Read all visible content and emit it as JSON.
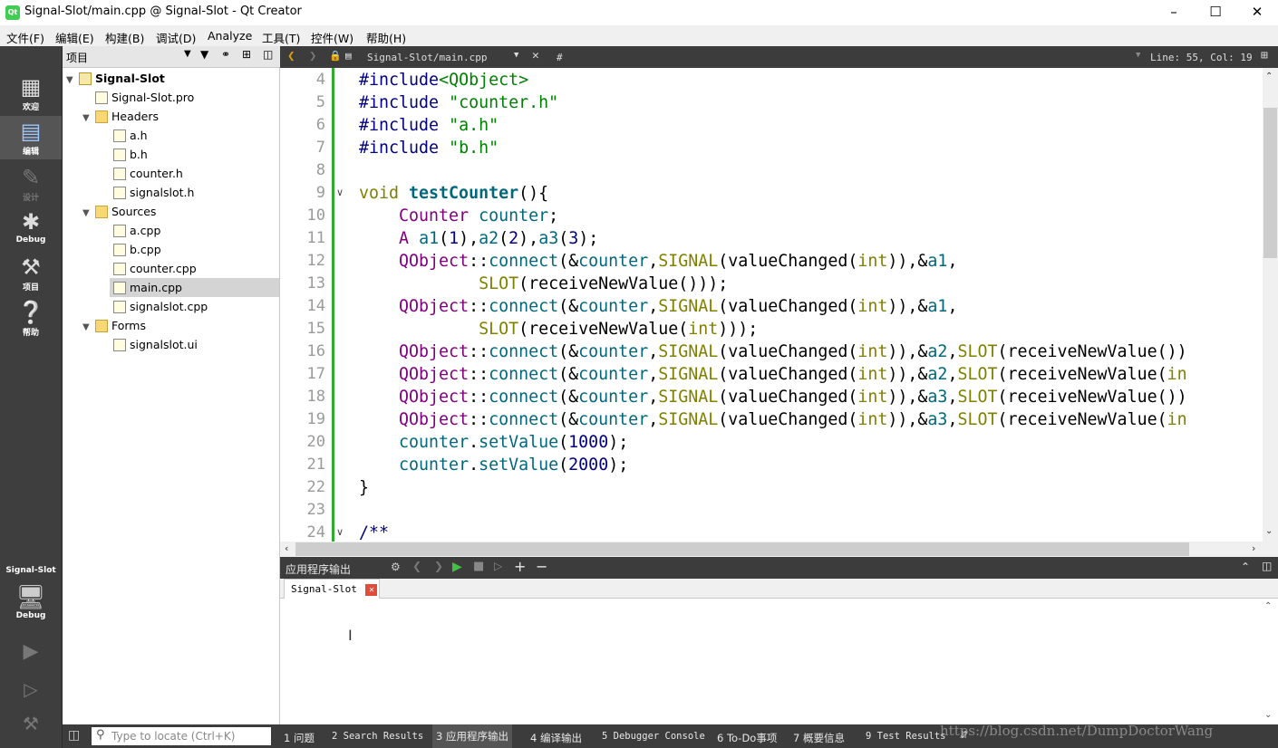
{
  "window": {
    "title": "Signal-Slot/main.cpp @ Signal-Slot - Qt Creator",
    "app_icon": "qt-creator-icon"
  },
  "menu": [
    "文件(F)",
    "编辑(E)",
    "构建(B)",
    "调试(D)",
    "Analyze",
    "工具(T)",
    "控件(W)",
    "帮助(H)"
  ],
  "modes": [
    {
      "label": "欢迎",
      "icon": "grid-icon"
    },
    {
      "label": "编辑",
      "icon": "document-icon"
    },
    {
      "label": "设计",
      "icon": "pen-icon"
    },
    {
      "label": "Debug",
      "icon": "bug-icon"
    },
    {
      "label": "项目",
      "icon": "wrench-icon"
    },
    {
      "label": "帮助",
      "icon": "help-icon"
    }
  ],
  "kit": {
    "project": "Signal-Slot",
    "config": "Debug"
  },
  "project_pane": {
    "title": "项目",
    "tree": [
      {
        "label": "Signal-Slot",
        "depth": 0,
        "type": "project",
        "bold": true
      },
      {
        "label": "Signal-Slot.pro",
        "depth": 1,
        "type": "file"
      },
      {
        "label": "Headers",
        "depth": 1,
        "type": "folder"
      },
      {
        "label": "a.h",
        "depth": 2,
        "type": "file"
      },
      {
        "label": "b.h",
        "depth": 2,
        "type": "file"
      },
      {
        "label": "counter.h",
        "depth": 2,
        "type": "file"
      },
      {
        "label": "signalslot.h",
        "depth": 2,
        "type": "file"
      },
      {
        "label": "Sources",
        "depth": 1,
        "type": "folder"
      },
      {
        "label": "a.cpp",
        "depth": 2,
        "type": "file"
      },
      {
        "label": "b.cpp",
        "depth": 2,
        "type": "file"
      },
      {
        "label": "counter.cpp",
        "depth": 2,
        "type": "file"
      },
      {
        "label": "main.cpp",
        "depth": 2,
        "type": "file",
        "selected": true
      },
      {
        "label": "signalslot.cpp",
        "depth": 2,
        "type": "file"
      },
      {
        "label": "Forms",
        "depth": 1,
        "type": "folder"
      },
      {
        "label": "signalslot.ui",
        "depth": 2,
        "type": "file"
      }
    ]
  },
  "editor": {
    "file": "Signal-Slot/main.cpp",
    "symbol": "#",
    "position": "Line: 55, Col: 19",
    "lines": [
      {
        "n": "4",
        "tokens": [
          [
            "pp",
            "#include"
          ],
          [
            "str",
            "<QObject>"
          ]
        ]
      },
      {
        "n": "5",
        "tokens": [
          [
            "pp",
            "#include "
          ],
          [
            "str",
            "\"counter.h\""
          ]
        ]
      },
      {
        "n": "6",
        "tokens": [
          [
            "pp",
            "#include "
          ],
          [
            "str",
            "\"a.h\""
          ]
        ]
      },
      {
        "n": "7",
        "tokens": [
          [
            "pp",
            "#include "
          ],
          [
            "str",
            "\"b.h\""
          ]
        ]
      },
      {
        "n": "8",
        "tokens": []
      },
      {
        "n": "9",
        "fold": true,
        "tokens": [
          [
            "kw",
            "void "
          ],
          [
            "fn",
            "testCounter"
          ],
          [
            "",
            "(){"
          ]
        ]
      },
      {
        "n": "10",
        "tokens": [
          [
            "",
            "    "
          ],
          [
            "ty",
            "Counter"
          ],
          [
            "",
            " "
          ],
          [
            "fc",
            "counter"
          ],
          [
            "",
            ";"
          ]
        ]
      },
      {
        "n": "11",
        "tokens": [
          [
            "",
            "    "
          ],
          [
            "ty",
            "A"
          ],
          [
            "",
            " "
          ],
          [
            "fc",
            "a1"
          ],
          [
            "",
            "("
          ],
          [
            "num",
            "1"
          ],
          [
            "",
            "),"
          ],
          [
            "fc",
            "a2"
          ],
          [
            "",
            "("
          ],
          [
            "num",
            "2"
          ],
          [
            "",
            "),"
          ],
          [
            "fc",
            "a3"
          ],
          [
            "",
            "("
          ],
          [
            "num",
            "3"
          ],
          [
            "",
            ");"
          ]
        ]
      },
      {
        "n": "12",
        "tokens": [
          [
            "",
            "    "
          ],
          [
            "ty",
            "QObject"
          ],
          [
            "",
            "::"
          ],
          [
            "fc",
            "connect"
          ],
          [
            "",
            "(&"
          ],
          [
            "fc",
            "counter"
          ],
          [
            "",
            ","
          ],
          [
            "mac",
            "SIGNAL"
          ],
          [
            "",
            "(valueChanged("
          ],
          [
            "kw",
            "int"
          ],
          [
            "",
            ")),&"
          ],
          [
            "fc",
            "a1"
          ],
          [
            "",
            ","
          ]
        ]
      },
      {
        "n": "13",
        "tokens": [
          [
            "",
            "            "
          ],
          [
            "mac",
            "SLOT"
          ],
          [
            "",
            "(receiveNewValue()));"
          ]
        ]
      },
      {
        "n": "14",
        "tokens": [
          [
            "",
            "    "
          ],
          [
            "ty",
            "QObject"
          ],
          [
            "",
            "::"
          ],
          [
            "fc",
            "connect"
          ],
          [
            "",
            "(&"
          ],
          [
            "fc",
            "counter"
          ],
          [
            "",
            ","
          ],
          [
            "mac",
            "SIGNAL"
          ],
          [
            "",
            "(valueChanged("
          ],
          [
            "kw",
            "int"
          ],
          [
            "",
            ")),&"
          ],
          [
            "fc",
            "a1"
          ],
          [
            "",
            ","
          ]
        ]
      },
      {
        "n": "15",
        "tokens": [
          [
            "",
            "            "
          ],
          [
            "mac",
            "SLOT"
          ],
          [
            "",
            "(receiveNewValue("
          ],
          [
            "kw",
            "int"
          ],
          [
            "",
            ")));"
          ]
        ]
      },
      {
        "n": "16",
        "tokens": [
          [
            "",
            "    "
          ],
          [
            "ty",
            "QObject"
          ],
          [
            "",
            "::"
          ],
          [
            "fc",
            "connect"
          ],
          [
            "",
            "(&"
          ],
          [
            "fc",
            "counter"
          ],
          [
            "",
            ","
          ],
          [
            "mac",
            "SIGNAL"
          ],
          [
            "",
            "(valueChanged("
          ],
          [
            "kw",
            "int"
          ],
          [
            "",
            ")),&"
          ],
          [
            "fc",
            "a2"
          ],
          [
            "",
            ","
          ],
          [
            "mac",
            "SLOT"
          ],
          [
            "",
            "(receiveNewValue())"
          ]
        ]
      },
      {
        "n": "17",
        "tokens": [
          [
            "",
            "    "
          ],
          [
            "ty",
            "QObject"
          ],
          [
            "",
            "::"
          ],
          [
            "fc",
            "connect"
          ],
          [
            "",
            "(&"
          ],
          [
            "fc",
            "counter"
          ],
          [
            "",
            ","
          ],
          [
            "mac",
            "SIGNAL"
          ],
          [
            "",
            "(valueChanged("
          ],
          [
            "kw",
            "int"
          ],
          [
            "",
            ")),&"
          ],
          [
            "fc",
            "a2"
          ],
          [
            "",
            ","
          ],
          [
            "mac",
            "SLOT"
          ],
          [
            "",
            "(receiveNewValue("
          ],
          [
            "kw",
            "in"
          ]
        ]
      },
      {
        "n": "18",
        "tokens": [
          [
            "",
            "    "
          ],
          [
            "ty",
            "QObject"
          ],
          [
            "",
            "::"
          ],
          [
            "fc",
            "connect"
          ],
          [
            "",
            "(&"
          ],
          [
            "fc",
            "counter"
          ],
          [
            "",
            ","
          ],
          [
            "mac",
            "SIGNAL"
          ],
          [
            "",
            "(valueChanged("
          ],
          [
            "kw",
            "int"
          ],
          [
            "",
            ")),&"
          ],
          [
            "fc",
            "a3"
          ],
          [
            "",
            ","
          ],
          [
            "mac",
            "SLOT"
          ],
          [
            "",
            "(receiveNewValue())"
          ]
        ]
      },
      {
        "n": "19",
        "tokens": [
          [
            "",
            "    "
          ],
          [
            "ty",
            "QObject"
          ],
          [
            "",
            "::"
          ],
          [
            "fc",
            "connect"
          ],
          [
            "",
            "(&"
          ],
          [
            "fc",
            "counter"
          ],
          [
            "",
            ","
          ],
          [
            "mac",
            "SIGNAL"
          ],
          [
            "",
            "(valueChanged("
          ],
          [
            "kw",
            "int"
          ],
          [
            "",
            ")),&"
          ],
          [
            "fc",
            "a3"
          ],
          [
            "",
            ","
          ],
          [
            "mac",
            "SLOT"
          ],
          [
            "",
            "(receiveNewValue("
          ],
          [
            "kw",
            "in"
          ]
        ]
      },
      {
        "n": "20",
        "tokens": [
          [
            "",
            "    "
          ],
          [
            "fc",
            "counter"
          ],
          [
            "",
            "."
          ],
          [
            "fc",
            "setValue"
          ],
          [
            "",
            "("
          ],
          [
            "num",
            "1000"
          ],
          [
            "",
            ");"
          ]
        ]
      },
      {
        "n": "21",
        "tokens": [
          [
            "",
            "    "
          ],
          [
            "fc",
            "counter"
          ],
          [
            "",
            "."
          ],
          [
            "fc",
            "setValue"
          ],
          [
            "",
            "("
          ],
          [
            "num",
            "2000"
          ],
          [
            "",
            ");"
          ]
        ]
      },
      {
        "n": "22",
        "tokens": [
          [
            "",
            "}"
          ]
        ]
      },
      {
        "n": "23",
        "tokens": []
      },
      {
        "n": "24",
        "fold": true,
        "tokens": [
          [
            "cmt",
            "/**"
          ]
        ]
      }
    ]
  },
  "output": {
    "title": "应用程序输出",
    "tab": "Signal-Slot"
  },
  "status": {
    "locate_placeholder": "Type to locate (Ctrl+K)",
    "tabs": [
      "1 问题",
      "2 Search Results",
      "3 应用程序输出",
      "4 编译输出",
      "5 Debugger Console",
      "6 To-Do事项",
      "7 概要信息",
      "9 Test Results"
    ],
    "watermark": "https://blog.csdn.net/DumpDoctorWang"
  }
}
